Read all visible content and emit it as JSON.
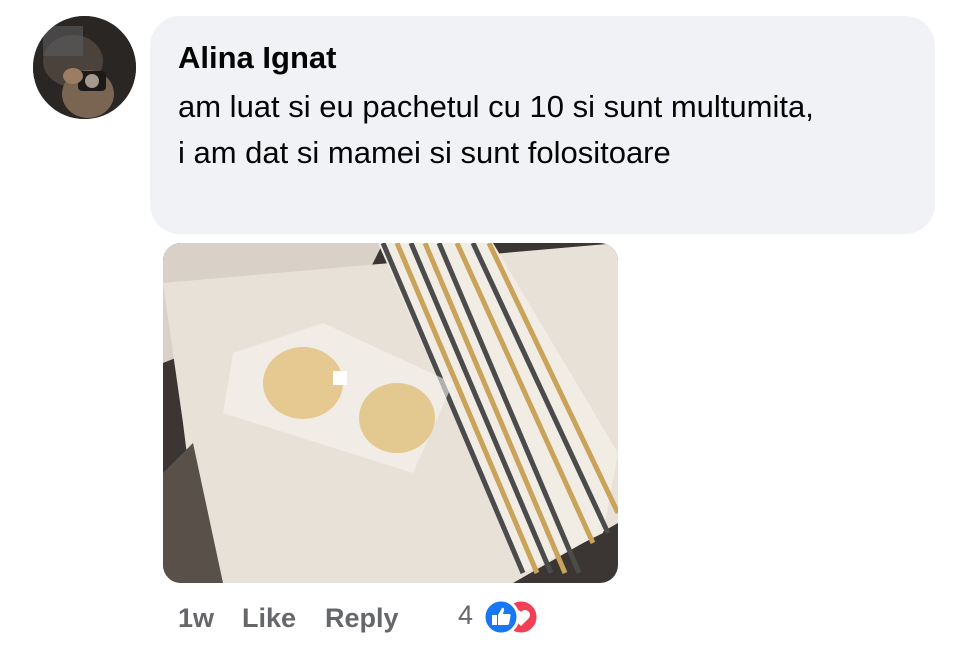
{
  "comment": {
    "author": "Alina Ignat",
    "text": "am luat si eu pachetul cu 10 si sunt multumita, i am dat si mamei si sunt folositoare",
    "avatar_icon": "profile-photo"
  },
  "actions": {
    "timestamp": "1w",
    "like_label": "Like",
    "reply_label": "Reply"
  },
  "reactions": {
    "count": "4",
    "icons": [
      "like-reaction-icon",
      "love-reaction-icon"
    ],
    "like_color": "#1877f2",
    "love_color": "#f33e58"
  },
  "colors": {
    "bubble": "#f0f2f5",
    "text": "#050505",
    "muted": "#65676b"
  }
}
